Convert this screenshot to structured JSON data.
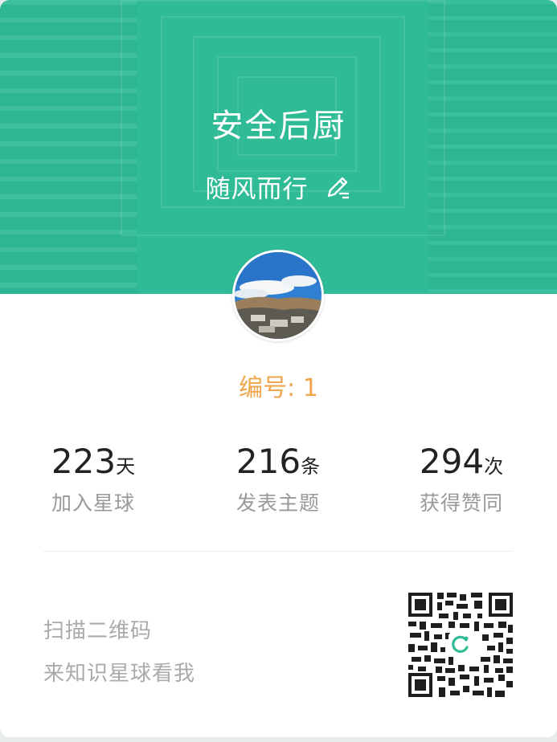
{
  "header": {
    "title": "安全后厨",
    "nickname": "随风而行",
    "bg_color": "#2fbb96"
  },
  "profile": {
    "serial_label": "编号: 1",
    "serial_color": "#efa64d"
  },
  "stats": [
    {
      "value": "223",
      "unit": "天",
      "label": "加入星球"
    },
    {
      "value": "216",
      "unit": "条",
      "label": "发表主题"
    },
    {
      "value": "294",
      "unit": "次",
      "label": "获得赞同"
    }
  ],
  "footer": {
    "line1": "扫描二维码",
    "line2": "来知识星球看我"
  },
  "icons": {
    "edit": "pencil-icon",
    "qr_center": "refresh-logo-icon"
  }
}
